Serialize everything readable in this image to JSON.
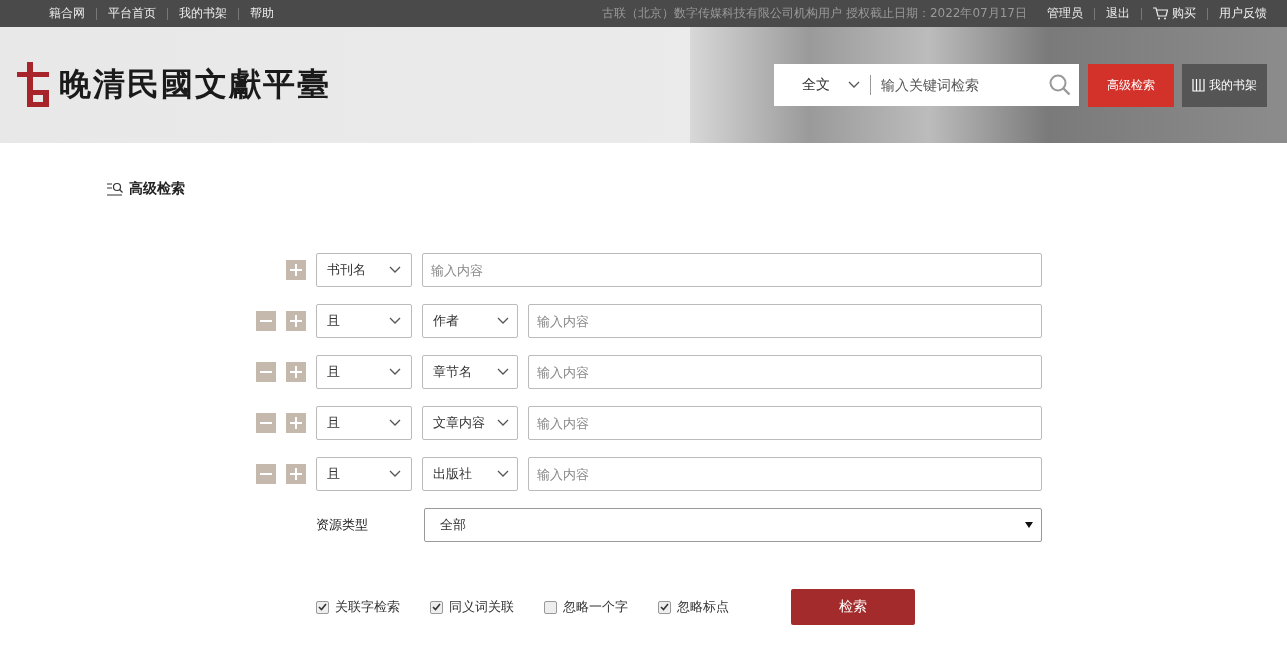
{
  "top_bar": {
    "left_links": [
      "籍合网",
      "平台首页",
      "我的书架",
      "帮助"
    ],
    "license": "古联（北京）数字传媒科技有限公司机构用户 授权截止日期：2022年07月17日",
    "right_links": [
      {
        "label": "管理员",
        "kind": "text"
      },
      {
        "label": "退出",
        "kind": "text"
      },
      {
        "label": "购买",
        "kind": "cart"
      },
      {
        "label": "用户反馈",
        "kind": "text"
      }
    ]
  },
  "header": {
    "site_title": "晚清民國文獻平臺",
    "search": {
      "scope": "全文",
      "placeholder": "输入关键词检索"
    },
    "advanced_button": "高级检索",
    "shelf_button": "我的书架"
  },
  "section_title": "高级检索",
  "rows": [
    {
      "operator": null,
      "field": "书刊名",
      "placeholder": "输入内容"
    },
    {
      "operator": "且",
      "field": "作者",
      "placeholder": "输入内容"
    },
    {
      "operator": "且",
      "field": "章节名",
      "placeholder": "输入内容"
    },
    {
      "operator": "且",
      "field": "文章内容",
      "placeholder": "输入内容"
    },
    {
      "operator": "且",
      "field": "出版社",
      "placeholder": "输入内容"
    }
  ],
  "resource_type": {
    "label": "资源类型",
    "value": "全部"
  },
  "options": [
    {
      "label": "关联字检索",
      "checked": true
    },
    {
      "label": "同义词关联",
      "checked": true
    },
    {
      "label": "忽略一个字",
      "checked": false
    },
    {
      "label": "忽略标点",
      "checked": true
    }
  ],
  "search_button": "检索"
}
